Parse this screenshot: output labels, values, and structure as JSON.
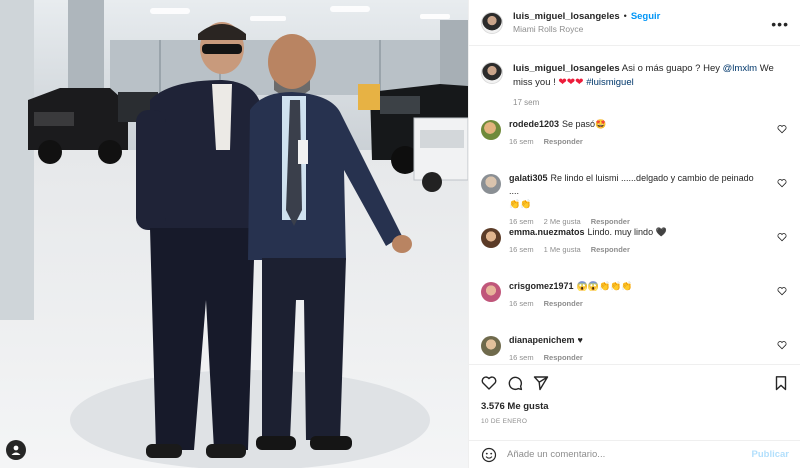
{
  "post": {
    "username": "luis_miguel_losangeles",
    "follow_label": "Seguir",
    "location": "Miami Rolls Royce",
    "caption_text": "Asi o más guapo ? Hey",
    "caption_mention": "@lmxlm",
    "caption_text2": "We miss you !",
    "caption_hearts": "❤❤❤",
    "caption_hashtag": "#luismiguel",
    "caption_time": "17 sem",
    "more_icon": "more-horizontal-icon"
  },
  "comments": [
    {
      "user": "rodede1203",
      "text": "Se pasó🤩",
      "time": "16 sem",
      "likes": "",
      "reply": "Responder"
    },
    {
      "user": "galati305",
      "text": "Re lindo el luismi ......delgado y cambio de peinado ....",
      "text2": "👏👏",
      "time": "16 sem",
      "likes": "2 Me gusta",
      "reply": "Responder"
    },
    {
      "user": "emma.nuezmatos",
      "text": "Lindo. muy lindo 🖤",
      "time": "16 sem",
      "likes": "1 Me gusta",
      "reply": "Responder"
    },
    {
      "user": "crisgomez1971",
      "text": "😱😱👏👏👏",
      "time": "16 sem",
      "likes": "",
      "reply": "Responder"
    },
    {
      "user": "dianapenichem",
      "text": "♥",
      "time": "16 sem",
      "likes": "",
      "reply": "Responder"
    }
  ],
  "actions": {
    "likes": "3.576 Me gusta",
    "date": "10 DE ENERO"
  },
  "add_comment": {
    "placeholder": "Añade un comentario...",
    "publish_label": "Publicar"
  },
  "colors": {
    "link_blue": "#0095f6",
    "mention_blue": "#00376b",
    "heart_red": "#ed1c3a",
    "muted_gray": "#8e8e8e"
  }
}
